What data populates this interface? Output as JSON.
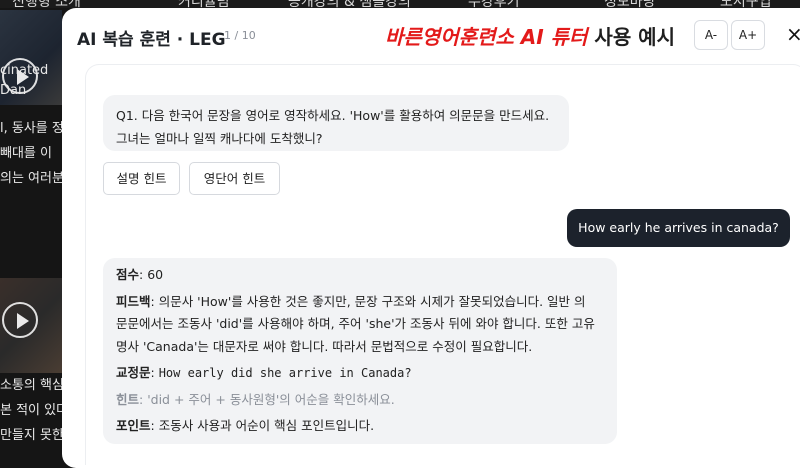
{
  "background": {
    "nav_items": [
      "진행형 소개",
      "커리큘럼",
      "공개강의 & 샘플강의",
      "수강후기",
      "정보마당",
      "도서구입"
    ],
    "left_snippets": [
      "cinated",
      "Dan",
      "l, 동사를 정",
      "빼대를 이",
      "의는 여러분",
      "소통의 핵심,",
      "본 적이 있다",
      "만들지 못한"
    ]
  },
  "modal": {
    "title": "AI 복습 훈련 · LEG",
    "counter": "1 / 10",
    "brand_red": "바른영어훈련소 AI 튜터",
    "brand_dark": " 사용 예시",
    "font_minus": "A-",
    "font_plus": "A+",
    "close": "×"
  },
  "chat": {
    "question_line1": "Q1. 다음 한국어 문장을 영어로 영작하세요. 'How'를 활용하여 의문문을 만드세요.",
    "question_line2": "그녀는 얼마나 일찍 캐나다에 도착했니?",
    "hint_buttons": [
      "설명 힌트",
      "영단어 힌트"
    ],
    "user_answer": "How early he arrives in canada?",
    "feedback": {
      "score_label": "점수",
      "score_value": ": 60",
      "feedback_label": "피드백",
      "feedback_line1": ": 의문사 'How'를 사용한 것은 좋지만, 문장 구조와 시제가 잘못되었습니다. 일반 의",
      "feedback_line2": "문문에서는 조동사 'did'를 사용해야 하며, 주어 'she'가 조동사 뒤에 와야 합니다. 또한 고유",
      "feedback_line3": "명사 'Canada'는 대문자로 써야 합니다. 따라서 문법적으로 수정이 필요합니다.",
      "correction_label": "교정문",
      "correction_sep": ": ",
      "correction_value": "How early did she arrive in Canada?",
      "hint_label": "힌트",
      "hint_value": ": 'did + 주어 + 동사원형'의 어순을 확인하세요.",
      "point_label": "포인트",
      "point_value": ": 조동사 사용과 어순이 핵심 포인트입니다."
    }
  }
}
